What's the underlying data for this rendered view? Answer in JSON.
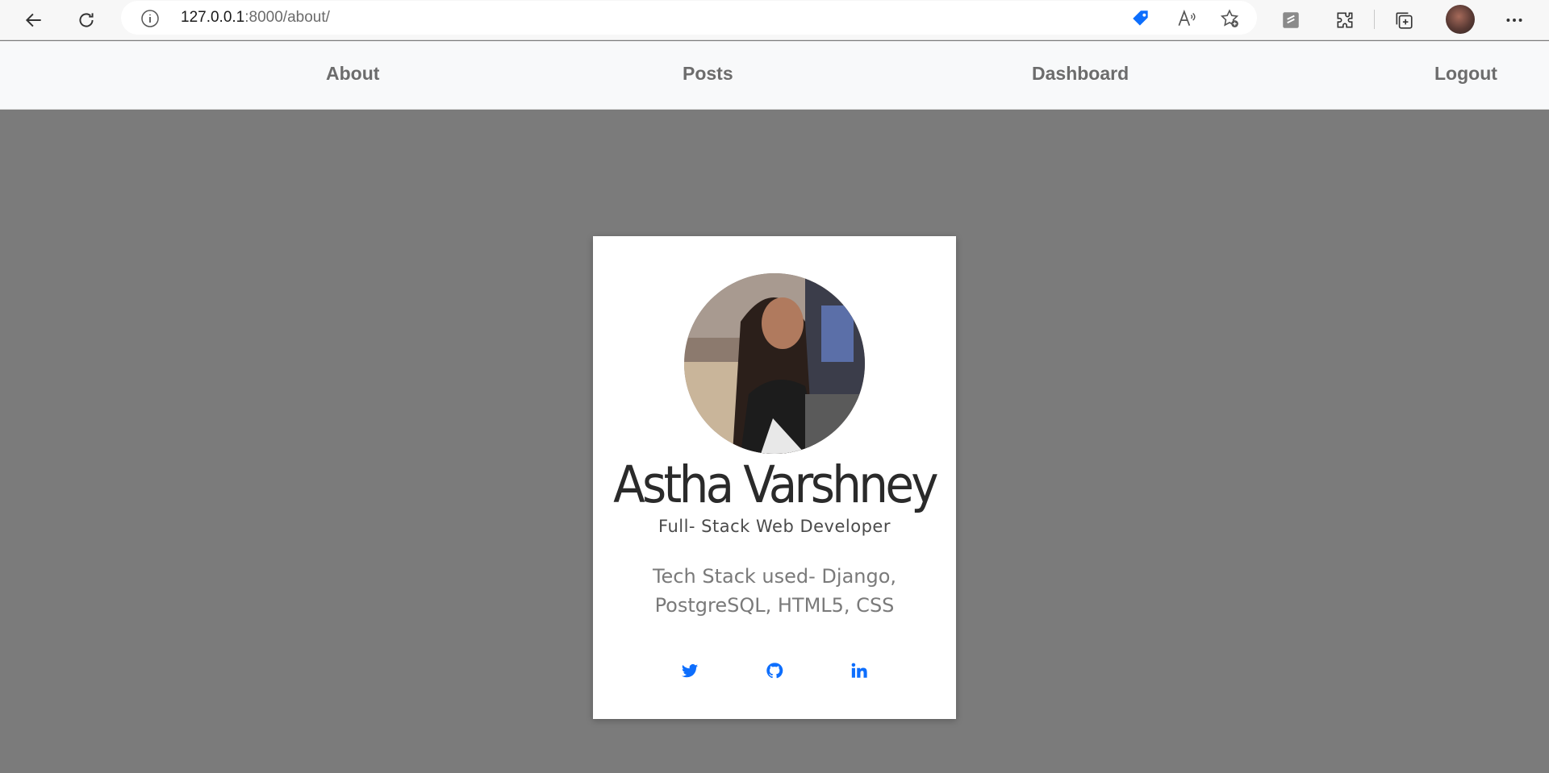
{
  "browser": {
    "url_host": "127.0.0.1",
    "url_path": ":8000/about/"
  },
  "nav": {
    "items": [
      {
        "label": "About"
      },
      {
        "label": "Posts"
      },
      {
        "label": "Dashboard"
      },
      {
        "label": "Logout"
      }
    ]
  },
  "profile": {
    "name": "Astha Varshney",
    "role": "Full- Stack Web Developer",
    "description": "Tech Stack used- Django, PostgreSQL, HTML5, CSS"
  },
  "social": {
    "icons": [
      "twitter-icon",
      "github-icon",
      "linkedin-icon"
    ]
  },
  "colors": {
    "background": "#7b7b7b",
    "accent": "#0d6efd",
    "nav_text": "#6c6c6c"
  }
}
